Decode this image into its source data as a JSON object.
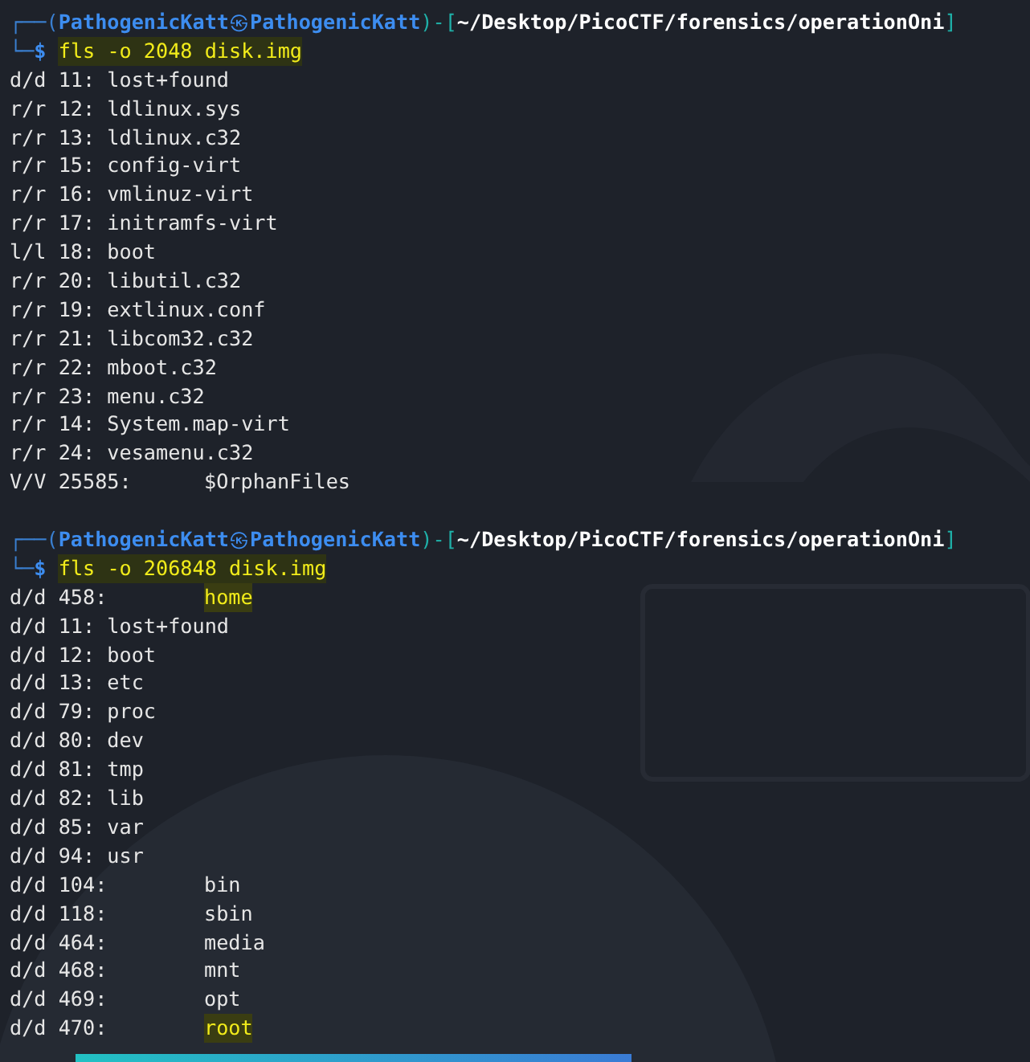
{
  "blocks": [
    {
      "prompt": {
        "corner_top": "┌──(",
        "user": "PathogenicKatt",
        "separator": "㉿",
        "host": "PathogenicKatt",
        "path_open": ")-[",
        "path": "~/Desktop/PicoCTF/forensics/operationOni",
        "path_close": "]",
        "corner_bottom": "└─",
        "symbol": "$",
        "command": "fls -o 2048 disk.img"
      },
      "entries": [
        {
          "kind": "plain",
          "entry": "d/d 11:",
          "name": "lost+found",
          "highlighted": false
        },
        {
          "kind": "plain",
          "entry": "r/r 12:",
          "name": "ldlinux.sys",
          "highlighted": false
        },
        {
          "kind": "plain",
          "entry": "r/r 13:",
          "name": "ldlinux.c32",
          "highlighted": false
        },
        {
          "kind": "plain",
          "entry": "r/r 15:",
          "name": "config-virt",
          "highlighted": false
        },
        {
          "kind": "plain",
          "entry": "r/r 16:",
          "name": "vmlinuz-virt",
          "highlighted": false
        },
        {
          "kind": "plain",
          "entry": "r/r 17:",
          "name": "initramfs-virt",
          "highlighted": false
        },
        {
          "kind": "plain",
          "entry": "l/l 18:",
          "name": "boot",
          "highlighted": false
        },
        {
          "kind": "plain",
          "entry": "r/r 20:",
          "name": "libutil.c32",
          "highlighted": false
        },
        {
          "kind": "plain",
          "entry": "r/r 19:",
          "name": "extlinux.conf",
          "highlighted": false
        },
        {
          "kind": "plain",
          "entry": "r/r 21:",
          "name": "libcom32.c32",
          "highlighted": false
        },
        {
          "kind": "plain",
          "entry": "r/r 22:",
          "name": "mboot.c32",
          "highlighted": false
        },
        {
          "kind": "plain",
          "entry": "r/r 23:",
          "name": "menu.c32",
          "highlighted": false
        },
        {
          "kind": "plain",
          "entry": "r/r 14:",
          "name": "System.map-virt",
          "highlighted": false
        },
        {
          "kind": "plain",
          "entry": "r/r 24:",
          "name": "vesamenu.c32",
          "highlighted": false
        },
        {
          "kind": "tab",
          "entry": "V/V 25585:",
          "name": "$OrphanFiles",
          "highlighted": false
        }
      ]
    },
    {
      "prompt": {
        "corner_top": "┌──(",
        "user": "PathogenicKatt",
        "separator": "㉿",
        "host": "PathogenicKatt",
        "path_open": ")-[",
        "path": "~/Desktop/PicoCTF/forensics/operationOni",
        "path_close": "]",
        "corner_bottom": "└─",
        "symbol": "$",
        "command": "fls -o 206848 disk.img"
      },
      "entries": [
        {
          "kind": "tab",
          "entry": "d/d 458:",
          "name": "home",
          "highlighted": true
        },
        {
          "kind": "plain",
          "entry": "d/d 11:",
          "name": "lost+found",
          "highlighted": false
        },
        {
          "kind": "plain",
          "entry": "d/d 12:",
          "name": "boot",
          "highlighted": false
        },
        {
          "kind": "plain",
          "entry": "d/d 13:",
          "name": "etc",
          "highlighted": false
        },
        {
          "kind": "plain",
          "entry": "d/d 79:",
          "name": "proc",
          "highlighted": false
        },
        {
          "kind": "plain",
          "entry": "d/d 80:",
          "name": "dev",
          "highlighted": false
        },
        {
          "kind": "plain",
          "entry": "d/d 81:",
          "name": "tmp",
          "highlighted": false
        },
        {
          "kind": "plain",
          "entry": "d/d 82:",
          "name": "lib",
          "highlighted": false
        },
        {
          "kind": "plain",
          "entry": "d/d 85:",
          "name": "var",
          "highlighted": false
        },
        {
          "kind": "plain",
          "entry": "d/d 94:",
          "name": "usr",
          "highlighted": false
        },
        {
          "kind": "tab",
          "entry": "d/d 104:",
          "name": "bin",
          "highlighted": false
        },
        {
          "kind": "tab",
          "entry": "d/d 118:",
          "name": "sbin",
          "highlighted": false
        },
        {
          "kind": "tab",
          "entry": "d/d 464:",
          "name": "media",
          "highlighted": false
        },
        {
          "kind": "tab",
          "entry": "d/d 468:",
          "name": "mnt",
          "highlighted": false
        },
        {
          "kind": "tab",
          "entry": "d/d 469:",
          "name": "opt",
          "highlighted": false
        },
        {
          "kind": "tab",
          "entry": "d/d 470:",
          "name": "root",
          "highlighted": true
        }
      ]
    }
  ]
}
